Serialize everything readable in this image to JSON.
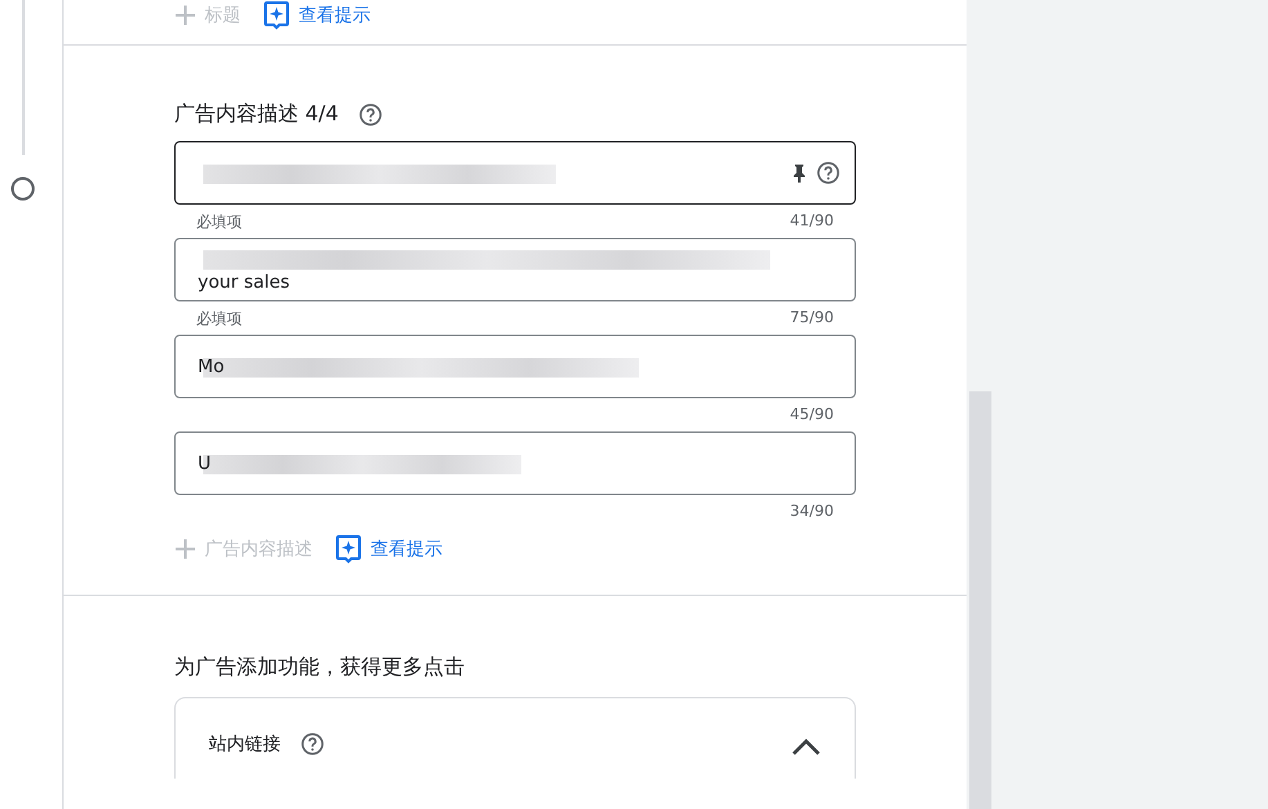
{
  "top_actions": {
    "add_label": "标题",
    "hint_link": "查看提示"
  },
  "descriptions": {
    "title": "广告内容描述 4/4",
    "fields": [
      {
        "focused": true,
        "pinned": true,
        "helper": "必填项",
        "count": "41/90"
      },
      {
        "value": "your sales",
        "focused": false,
        "pinned": false,
        "helper": "必填项",
        "count": "75/90"
      },
      {
        "value": "Mo",
        "focused": false,
        "pinned": false,
        "count": "45/90"
      },
      {
        "value": "U",
        "focused": false,
        "pinned": false,
        "count": "34/90"
      }
    ],
    "add_label": "广告内容描述",
    "hint_link": "查看提示"
  },
  "extensions": {
    "title": "为广告添加功能，获得更多点击",
    "card": {
      "title": "站内链接",
      "expanded": true
    }
  }
}
